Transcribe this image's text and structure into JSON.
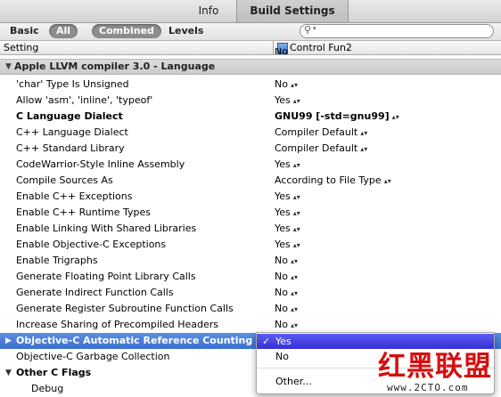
{
  "tabs": [
    {
      "label": "Info"
    },
    {
      "label": "Build Settings"
    }
  ],
  "filters": {
    "basic": "Basic",
    "all": "All",
    "combined": "Combined",
    "levels": "Levels"
  },
  "search": {
    "placeholder": ""
  },
  "columns": {
    "setting": "Setting",
    "target": "Control Fun2"
  },
  "partial_top_value": "No",
  "section": {
    "label": "Apple LLVM compiler 3.0 - Language"
  },
  "rows": [
    {
      "name": "'char' Type Is Unsigned",
      "value": "No"
    },
    {
      "name": "Allow 'asm', 'inline', 'typeof'",
      "value": "Yes"
    },
    {
      "name": "C Language Dialect",
      "value": "GNU99 [-std=gnu99]"
    },
    {
      "name": "C++ Language Dialect",
      "value": "Compiler Default"
    },
    {
      "name": "C++ Standard Library",
      "value": "Compiler Default"
    },
    {
      "name": "CodeWarrior-Style Inline Assembly",
      "value": "Yes"
    },
    {
      "name": "Compile Sources As",
      "value": "According to File Type"
    },
    {
      "name": "Enable C++ Exceptions",
      "value": "Yes"
    },
    {
      "name": "Enable C++ Runtime Types",
      "value": "Yes"
    },
    {
      "name": "Enable Linking With Shared Libraries",
      "value": "Yes"
    },
    {
      "name": "Enable Objective-C Exceptions",
      "value": "Yes"
    },
    {
      "name": "Enable Trigraphs",
      "value": "No"
    },
    {
      "name": "Generate Floating Point Library Calls",
      "value": "No"
    },
    {
      "name": "Generate Indirect Function Calls",
      "value": "No"
    },
    {
      "name": "Generate Register Subroutine Function Calls",
      "value": "No"
    },
    {
      "name": "Increase Sharing of Precompiled Headers",
      "value": "No"
    },
    {
      "name": "Objective-C Automatic Reference Counting",
      "value": ""
    },
    {
      "name": "Objective-C Garbage Collection",
      "value": ""
    },
    {
      "name": "Other C Flags",
      "value": ""
    },
    {
      "name": "Debug",
      "value": ""
    }
  ],
  "menu": {
    "check": "✓",
    "items": [
      "Yes",
      "No",
      "Other..."
    ]
  },
  "watermark": {
    "text": "红黑联盟",
    "url": "www.2CTO.com"
  }
}
